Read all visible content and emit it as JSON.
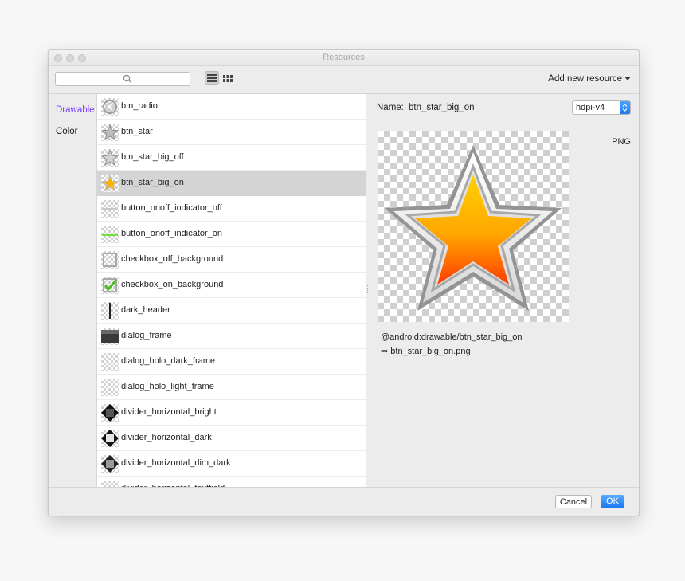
{
  "window": {
    "title": "Resources"
  },
  "toolbar": {
    "search_placeholder": "",
    "list_view_icon": "list-view-icon",
    "grid_view_icon": "grid-view-icon",
    "add_resource_label": "Add new resource"
  },
  "categories": [
    {
      "label": "Drawable",
      "selected": true
    },
    {
      "label": "Color",
      "selected": false
    }
  ],
  "resources": [
    {
      "label": "btn_radio",
      "icon": "radio-icon"
    },
    {
      "label": "btn_star",
      "icon": "star-outline-icon"
    },
    {
      "label": "btn_star_big_off",
      "icon": "star-gray-icon"
    },
    {
      "label": "btn_star_big_on",
      "icon": "star-gold-icon",
      "selected": true
    },
    {
      "label": "button_onoff_indicator_off",
      "icon": "indicator-off-icon"
    },
    {
      "label": "button_onoff_indicator_on",
      "icon": "indicator-on-icon"
    },
    {
      "label": "checkbox_off_background",
      "icon": "checkbox-off-icon"
    },
    {
      "label": "checkbox_on_background",
      "icon": "checkbox-on-icon"
    },
    {
      "label": "dark_header",
      "icon": "dark-header-icon"
    },
    {
      "label": "dialog_frame",
      "icon": "dialog-frame-icon"
    },
    {
      "label": "dialog_holo_dark_frame",
      "icon": "transparent-icon"
    },
    {
      "label": "dialog_holo_light_frame",
      "icon": "transparent-icon"
    },
    {
      "label": "divider_horizontal_bright",
      "icon": "divider-icon"
    },
    {
      "label": "divider_horizontal_dark",
      "icon": "divider-icon"
    },
    {
      "label": "divider_horizontal_dim_dark",
      "icon": "divider-icon"
    },
    {
      "label": "divider_horizontal_textfield",
      "icon": "transparent-icon"
    }
  ],
  "detail": {
    "name_label": "Name:",
    "name_value": "btn_star_big_on",
    "density": "hdpi-v4",
    "format": "PNG",
    "reference": "@android:drawable/btn_star_big_on",
    "file": "⇒ btn_star_big_on.png"
  },
  "footer": {
    "cancel_label": "Cancel",
    "ok_label": "OK"
  },
  "colors": {
    "accent": "#1a75f0",
    "category_selected": "#7a3cff",
    "star_gold": "#ffc300",
    "star_orange": "#ff5a00"
  }
}
